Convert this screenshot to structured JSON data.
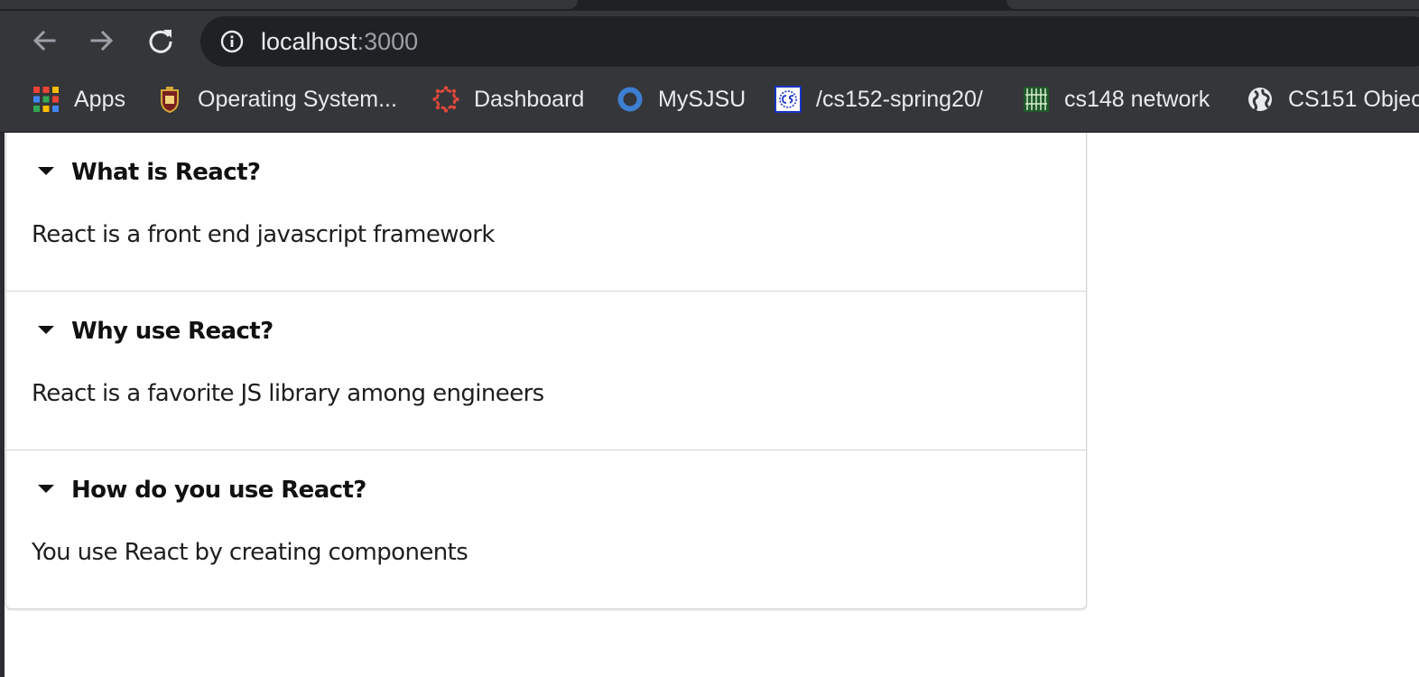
{
  "browser": {
    "url_host": "localhost",
    "url_port": ":3000",
    "bookmarks": [
      {
        "label": "Apps",
        "icon": "apps-grid-icon"
      },
      {
        "label": "Operating System...",
        "icon": "crest-icon"
      },
      {
        "label": "Dashboard",
        "icon": "canvas-icon"
      },
      {
        "label": "MySJSU",
        "icon": "ring-icon"
      },
      {
        "label": "/cs152-spring20/",
        "icon": "cs-icon"
      },
      {
        "label": "cs148 network",
        "icon": "chip-icon"
      },
      {
        "label": "CS151 Objec",
        "icon": "globe-icon"
      }
    ]
  },
  "accordion": {
    "items": [
      {
        "title": "What is React?",
        "content": "React is a front end javascript framework"
      },
      {
        "title": "Why use React?",
        "content": "React is a favorite JS library among engineers"
      },
      {
        "title": "How do you use React?",
        "content": "You use React by creating components"
      }
    ]
  },
  "colors": {
    "chrome_bg": "#35363a",
    "omnibox_bg": "#202124",
    "divider": "#d4d4d5",
    "text": "#1e1e1e"
  }
}
